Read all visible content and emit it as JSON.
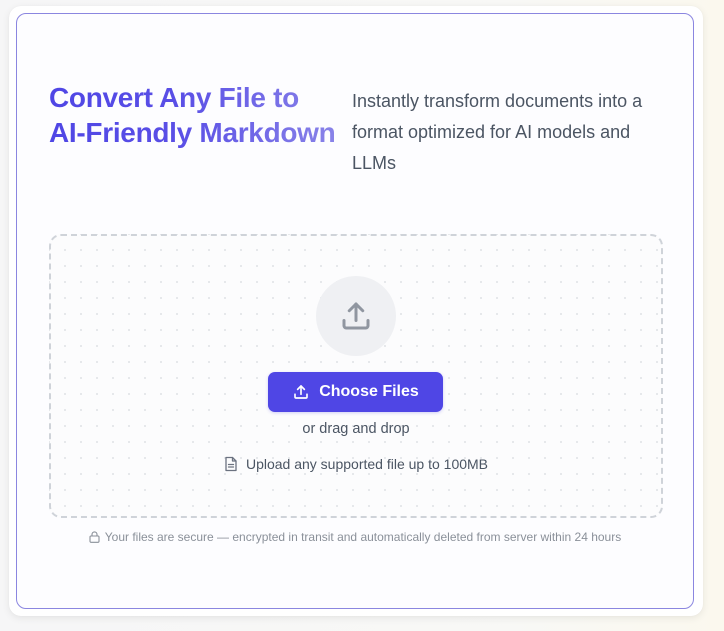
{
  "hero": {
    "headline": "Convert Any File to AI-Friendly Markdown",
    "subhead": "Instantly transform documents into a format optimized for AI models and LLMs"
  },
  "dropzone": {
    "upload_icon": "upload-icon",
    "button_icon": "upload-icon",
    "button_label": "Choose Files",
    "drag_text": "or drag and drop",
    "limit_icon": "document-icon",
    "limit_text": "Upload any supported file up to 100MB"
  },
  "security": {
    "icon": "lock-icon",
    "text": "Your files are secure — encrypted in transit and automatically deleted from server within 24 hours"
  },
  "colors": {
    "accent": "#4f46e5",
    "card_border": "#8b86e0",
    "dropzone_border": "#cfd3d9",
    "muted_text": "#8a9099"
  }
}
